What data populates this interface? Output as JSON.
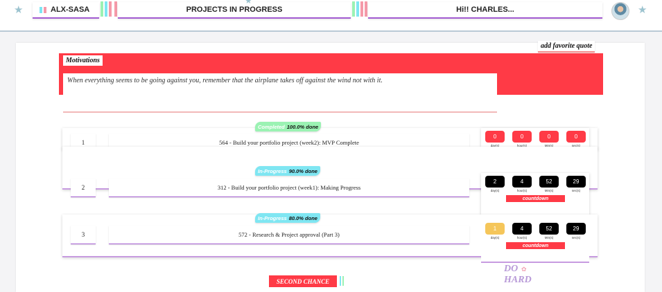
{
  "header": {
    "brand": "ALX-SASA",
    "title": "PROJECTS IN PROGRESS",
    "greeting": "Hi!! CHARLES...",
    "avatar_icon": "user-avatar",
    "star_icon": "star-icon"
  },
  "favorite_quote_label": "add favorite quote",
  "motivation": {
    "label": "Motivations",
    "quote": "When everything seems to be going against you, remember that the airplane takes off against the wind not with it."
  },
  "projects": [
    {
      "index": "1",
      "task": "564  -  Build your portfolio project (week2): MVP Complete",
      "status": "Completed",
      "percent": "100.0% done",
      "status_color": "#9bf2b3",
      "countdown": {
        "days": "0",
        "hours": "0",
        "mins": "0",
        "secs": "0"
      },
      "countdown_color": "#ff3a46",
      "countdown_label": "countdown"
    },
    {
      "index": "2",
      "task": "312  -  Build your portfolio project (week1): Making Progress",
      "status": "In-Progress",
      "percent": "90.0% done",
      "status_color": "#7fe6f2",
      "countdown": {
        "days": "2",
        "hours": "4",
        "mins": "52",
        "secs": "29"
      },
      "countdown_color": "#000000",
      "countdown_label": "countdown"
    },
    {
      "index": "3",
      "task": "572  -  Research & Project approval (Part 3)",
      "status": "In-Progress",
      "percent": "80.0% done",
      "status_color": "#7fe6f2",
      "countdown": {
        "days": "1",
        "hours": "4",
        "mins": "52",
        "secs": "29"
      },
      "countdown_color": "#000000",
      "days_color": "#f5c65a",
      "countdown_label": "countdown"
    }
  ],
  "unit_labels": {
    "days": "day(s)",
    "hours": "hour(s)",
    "mins": "Min(s)",
    "secs": "sec(s)"
  },
  "second_chance_label": "SECOND CHANCE",
  "motto": [
    "DO",
    "HARD"
  ],
  "colors": {
    "accent_red": "#ff3a46",
    "purple_line": "#a25ad0",
    "mint": "#9bf2b3",
    "cyan": "#7fe6f2"
  }
}
